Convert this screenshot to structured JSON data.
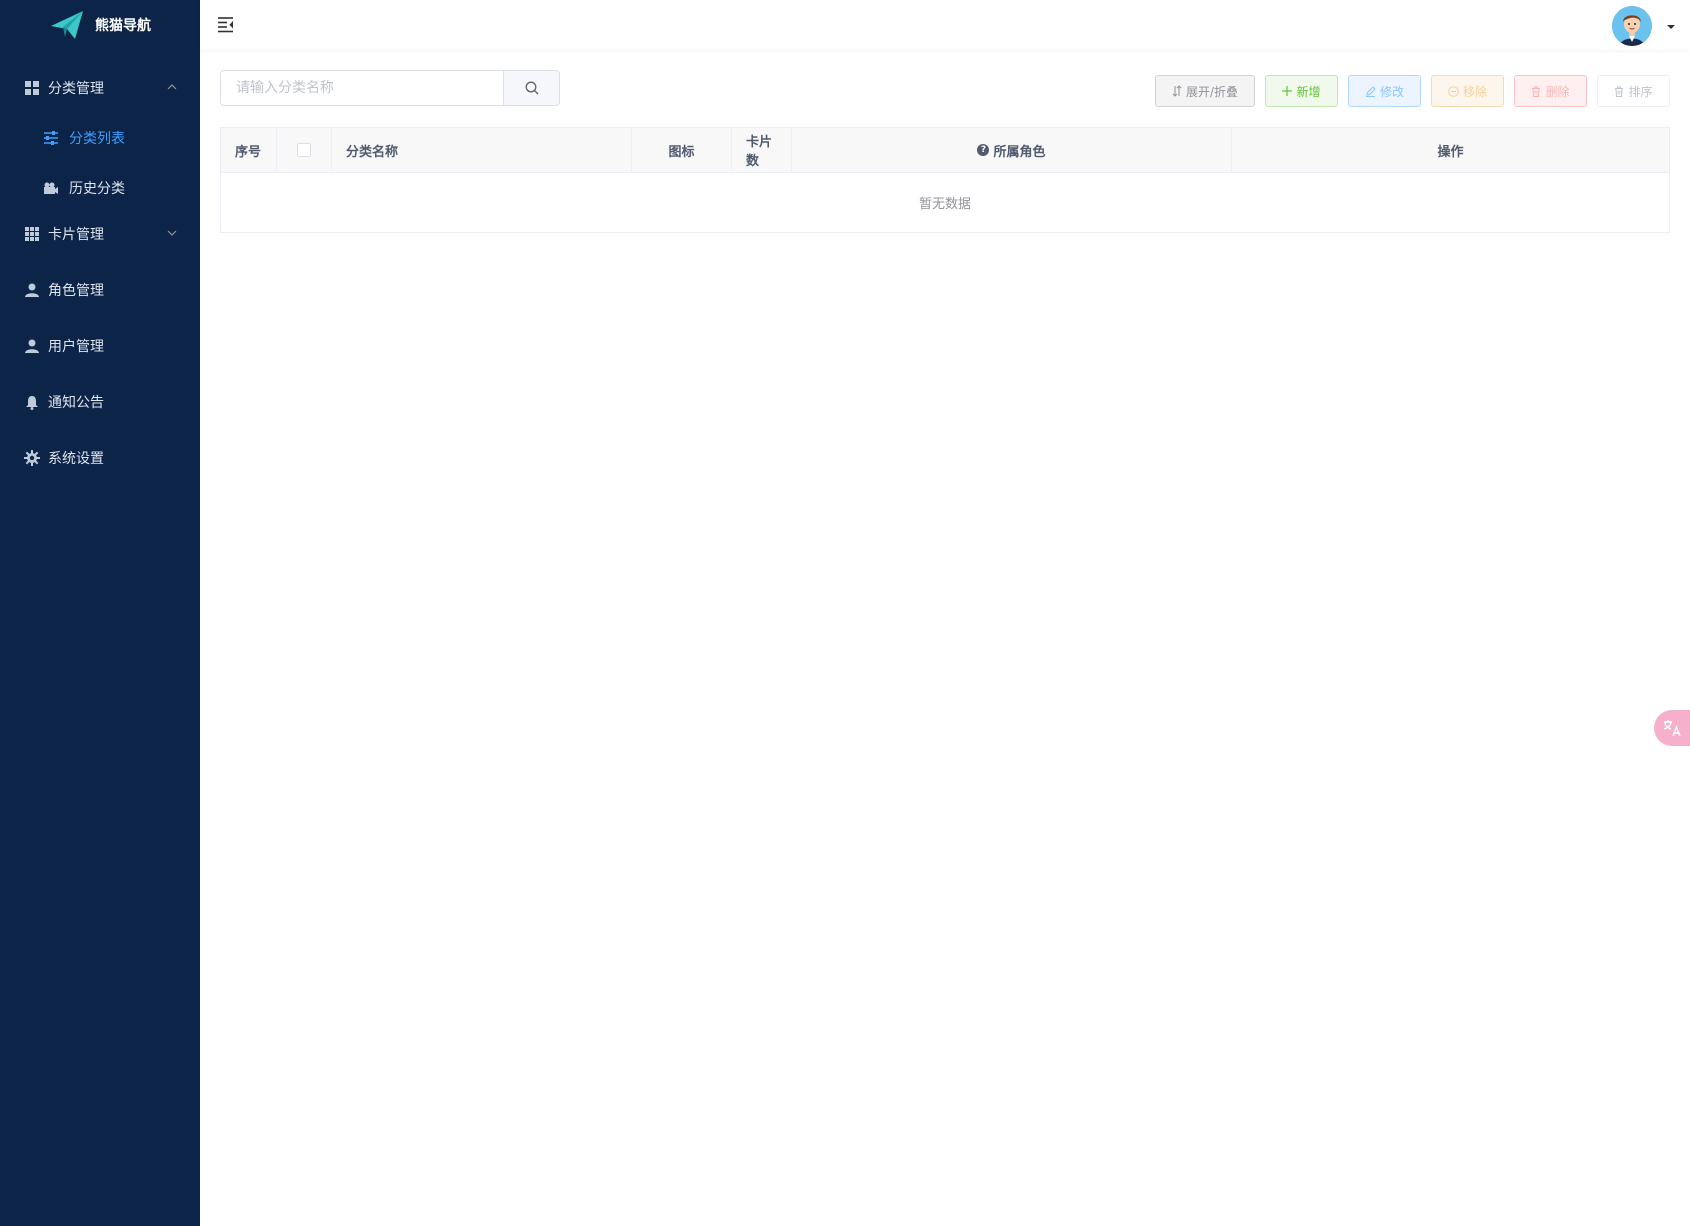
{
  "app": {
    "logo_text": "熊猫导航"
  },
  "sidebar": {
    "groups": [
      {
        "label": "分类管理",
        "icon": "grid-icon",
        "expanded": true,
        "children": [
          {
            "label": "分类列表",
            "icon": "sliders-icon",
            "active": true
          },
          {
            "label": "历史分类",
            "icon": "history-icon",
            "active": false
          }
        ]
      },
      {
        "label": "卡片管理",
        "icon": "apps-icon",
        "expanded": false
      },
      {
        "label": "角色管理",
        "icon": "user-icon"
      },
      {
        "label": "用户管理",
        "icon": "user-icon"
      },
      {
        "label": "通知公告",
        "icon": "bell-icon"
      },
      {
        "label": "系统设置",
        "icon": "gear-icon"
      }
    ]
  },
  "search": {
    "placeholder": "请输入分类名称",
    "value": ""
  },
  "toolbar": {
    "expand_label": "展开/折叠",
    "add_label": "新增",
    "edit_label": "修改",
    "move_label": "移除",
    "delete_label": "删除",
    "sort_label": "排序"
  },
  "table": {
    "columns": [
      "序号",
      "",
      "分类名称",
      "图标",
      "卡片数",
      "所属角色",
      "操作"
    ],
    "empty_text": "暂无数据",
    "rows": []
  },
  "colors": {
    "sidebar_bg": "#0b2448",
    "accent": "#409eff",
    "success": "#67c23a",
    "warning": "#e6a23c",
    "danger": "#f56c6c"
  }
}
